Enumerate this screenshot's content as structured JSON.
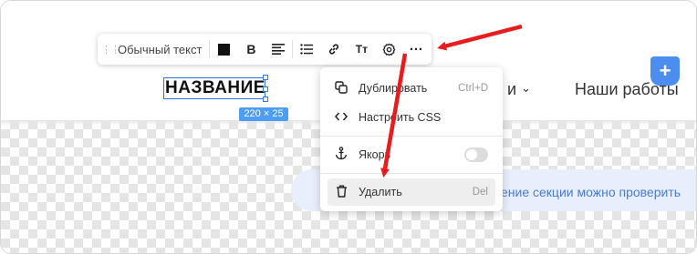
{
  "toolbar": {
    "text_style": "Обычный текст",
    "bold_label": "B",
    "text_size_label": "Тт",
    "icons": [
      "drag-handle-icon",
      "color-swatch",
      "bold-icon",
      "align-icon",
      "list-icon",
      "link-icon",
      "text-size-icon",
      "settings-icon",
      "more-icon"
    ],
    "more_label": "···"
  },
  "header": {
    "title": "НАЗВАНИЕ",
    "size_tag": "220 × 25",
    "nav_partial": "и",
    "nav_works": "Наши работы",
    "plus_label": "+"
  },
  "context_menu": {
    "items": [
      {
        "label": "Дублировать",
        "shortcut": "Ctrl+D",
        "icon": "duplicate-icon"
      },
      {
        "label": "Настроить CSS",
        "shortcut": "",
        "icon": "code-icon"
      },
      {
        "label": "Якорь",
        "shortcut": "",
        "icon": "anchor-icon",
        "toggle": false
      },
      {
        "label": "Удалить",
        "shortcut": "Del",
        "icon": "trash-icon"
      }
    ]
  },
  "banner": {
    "text": "ение секции можно проверить"
  },
  "colors": {
    "accent": "#2d7be0",
    "plus": "#4c8ef0",
    "arrow": "#e81c1c",
    "banner_bg": "#e8effc",
    "banner_text": "#4b7bd0"
  }
}
